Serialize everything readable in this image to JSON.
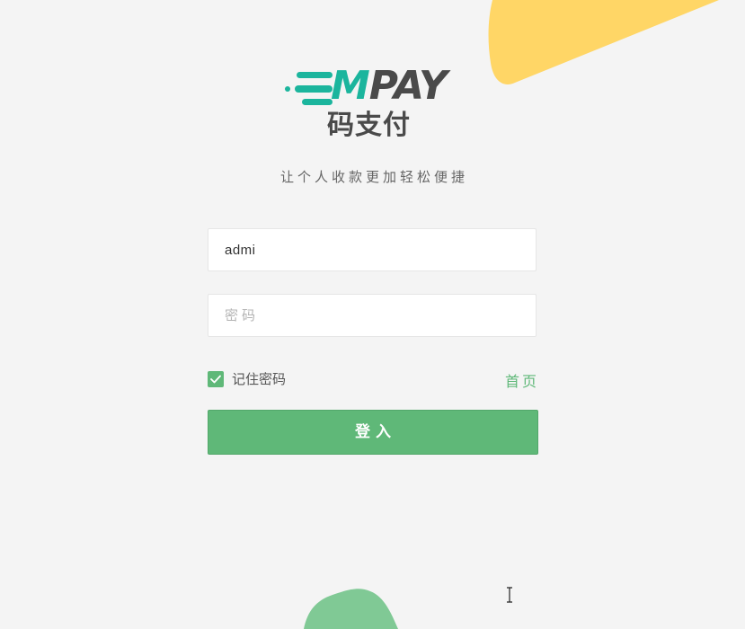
{
  "logo": {
    "brand_m": "M",
    "brand_rest": "PAY",
    "brand_cn": "码支付"
  },
  "slogan": "让个人收款更加轻松便捷",
  "form": {
    "username_value": "admi",
    "password_placeholder": "密码",
    "remember_label": "记住密码",
    "remember_checked": true,
    "home_link": "首页",
    "login_label": "登入"
  },
  "colors": {
    "accent": "#5fb878",
    "logo_teal": "#1bb59d",
    "logo_dark": "#4a4a4a",
    "blob_yellow": "#ffd666",
    "blob_green": "#80c995",
    "background": "#f4f4f4"
  },
  "icons": {
    "checkbox": "check-icon",
    "cursor": "text-cursor-icon"
  }
}
